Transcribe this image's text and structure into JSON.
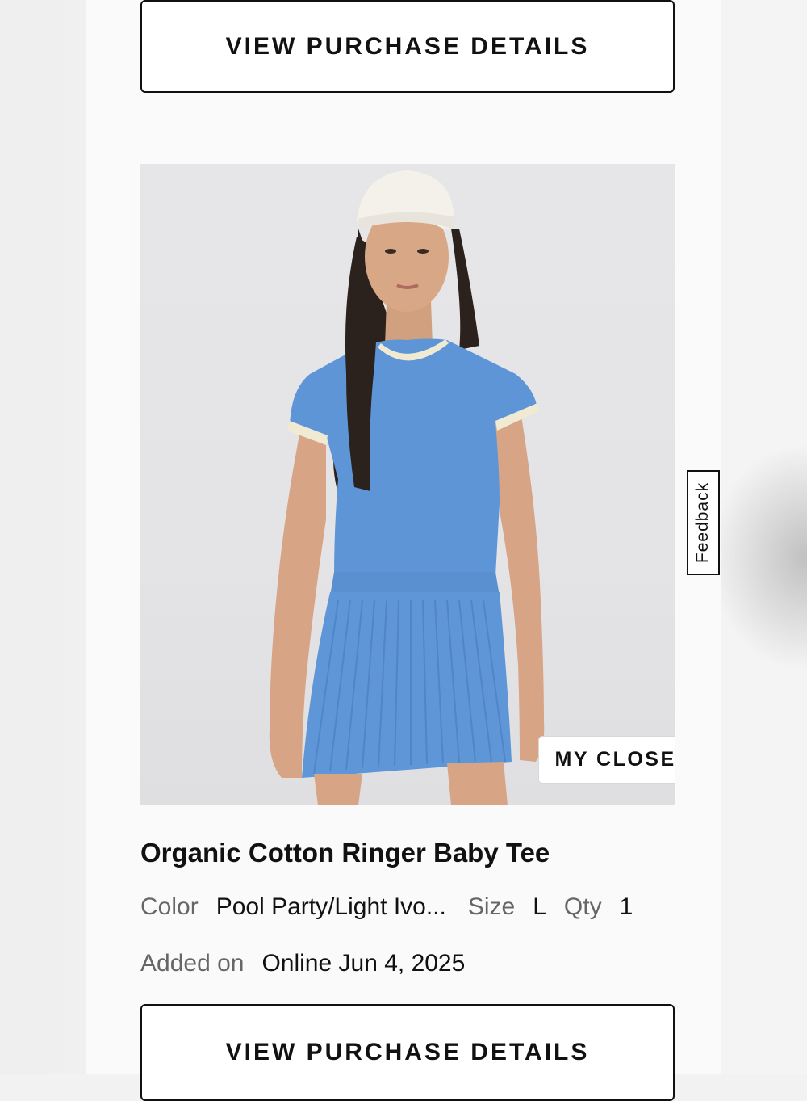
{
  "top_button": {
    "label": "VIEW PURCHASE DETAILS"
  },
  "product": {
    "image_badge": "MY CLOSET",
    "name": "Organic Cotton Ringer Baby Tee",
    "color_label": "Color",
    "color_value": "Pool Party/Light Ivo...",
    "size_label": "Size",
    "size_value": "L",
    "qty_label": "Qty",
    "qty_value": "1",
    "added_label": "Added on",
    "added_value": "Online Jun 4, 2025"
  },
  "bottom_button": {
    "label": "VIEW PURCHASE DETAILS"
  },
  "feedback_tab": {
    "label": "Feedback"
  },
  "colors": {
    "shirt": "#5e95d6",
    "trim": "#f0ead2",
    "background": "#e4e4e6"
  }
}
